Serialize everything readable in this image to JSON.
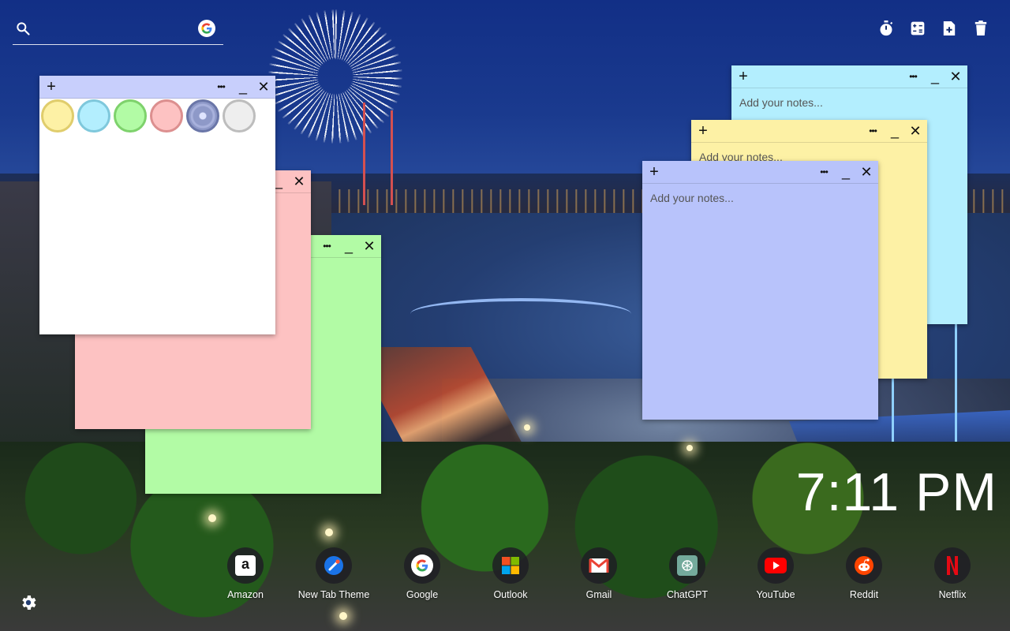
{
  "search": {
    "placeholder": "",
    "value": "",
    "engine_icon": "google-icon"
  },
  "toolbar": [
    {
      "name": "timer-icon"
    },
    {
      "name": "calculator-icon"
    },
    {
      "name": "add-note-icon"
    },
    {
      "name": "trash-icon"
    }
  ],
  "notes": [
    {
      "id": "cyan",
      "color": "#b3eefe",
      "placeholder": "Add your notes..."
    },
    {
      "id": "yellow",
      "color": "#fdf1a5",
      "placeholder": "Add your notes..."
    },
    {
      "id": "blue",
      "color": "#b8c3fb",
      "placeholder": "Add your notes..."
    },
    {
      "id": "green",
      "color": "#b2fba5",
      "placeholder": ""
    },
    {
      "id": "pink",
      "color": "#fdc2c2",
      "placeholder": ""
    },
    {
      "id": "white",
      "color": "#ffffff",
      "placeholder": ""
    }
  ],
  "note_controls": {
    "add": "+",
    "menu": "•••",
    "minimize": "_",
    "close": "✕"
  },
  "color_palette": [
    {
      "name": "yellow",
      "color": "#fdf1a5",
      "ring": "#e0cd6c"
    },
    {
      "name": "cyan",
      "color": "#b3eefe",
      "ring": "#7fc8dc"
    },
    {
      "name": "green",
      "color": "#b2fba5",
      "ring": "#7ed26c"
    },
    {
      "name": "pink",
      "color": "#fdc2c2",
      "ring": "#dc8f8f"
    },
    {
      "name": "blue",
      "color": "#8e99c8",
      "ring": "#6a76a8"
    },
    {
      "name": "white",
      "color": "#eeeeee",
      "ring": "#bdbdbd"
    }
  ],
  "clock": {
    "time": "7:11 PM"
  },
  "dock": [
    {
      "label": "Amazon",
      "icon": "amazon-icon"
    },
    {
      "label": "New Tab Theme",
      "icon": "new-tab-theme-icon"
    },
    {
      "label": "Google",
      "icon": "google-icon"
    },
    {
      "label": "Outlook",
      "icon": "outlook-icon"
    },
    {
      "label": "Gmail",
      "icon": "gmail-icon"
    },
    {
      "label": "ChatGPT",
      "icon": "chatgpt-icon"
    },
    {
      "label": "YouTube",
      "icon": "youtube-icon"
    },
    {
      "label": "Reddit",
      "icon": "reddit-icon"
    },
    {
      "label": "Netflix",
      "icon": "netflix-icon"
    }
  ],
  "settings": {
    "icon": "gear-icon"
  }
}
